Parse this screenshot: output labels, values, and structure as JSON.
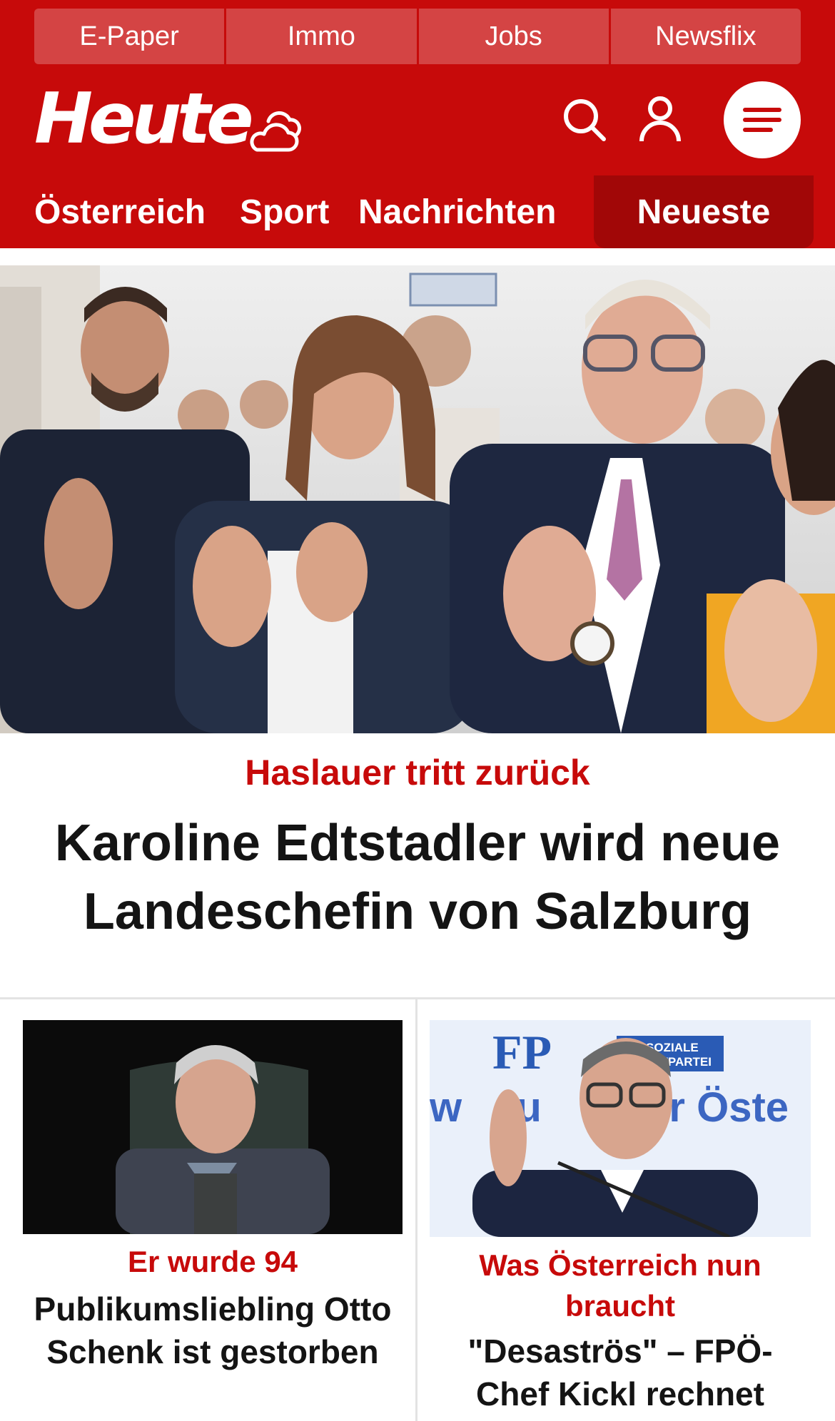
{
  "topbar": {
    "items": [
      "E-Paper",
      "Immo",
      "Jobs",
      "Newsflix"
    ]
  },
  "brand": {
    "logo_text": "Heute",
    "color": "#c70a0a",
    "accent_dark": "#a10707"
  },
  "icons": [
    "weather-icon",
    "search-icon",
    "user-icon",
    "menu-icon"
  ],
  "nav": {
    "items": [
      "Österreich",
      "Sport",
      "Nachrichten"
    ],
    "active": "Neueste"
  },
  "hero": {
    "kicker": "Haslauer tritt zurück",
    "headline_line1": "Karoline Edtstadler wird neue",
    "headline_line2": "Landeschefin von Salzburg"
  },
  "cards": [
    {
      "kicker": "Er wurde 94",
      "headline_line1": "Publikumsliebling Otto",
      "headline_line2": "Schenk ist gestorben"
    },
    {
      "kicker_line1": "Was Österreich nun",
      "kicker_line2": "braucht",
      "headline_line1": "\"Desaströs\" – FPÖ-",
      "headline_line2": "Chef Kickl rechnet",
      "image_text": {
        "logo": "FP",
        "tagline": "DIE SOZIALE",
        "tagline2": "HEIMATPARTEI",
        "banner_left": "w",
        "banner_mid": "tu",
        "banner_right": "ür Öste"
      }
    }
  ]
}
